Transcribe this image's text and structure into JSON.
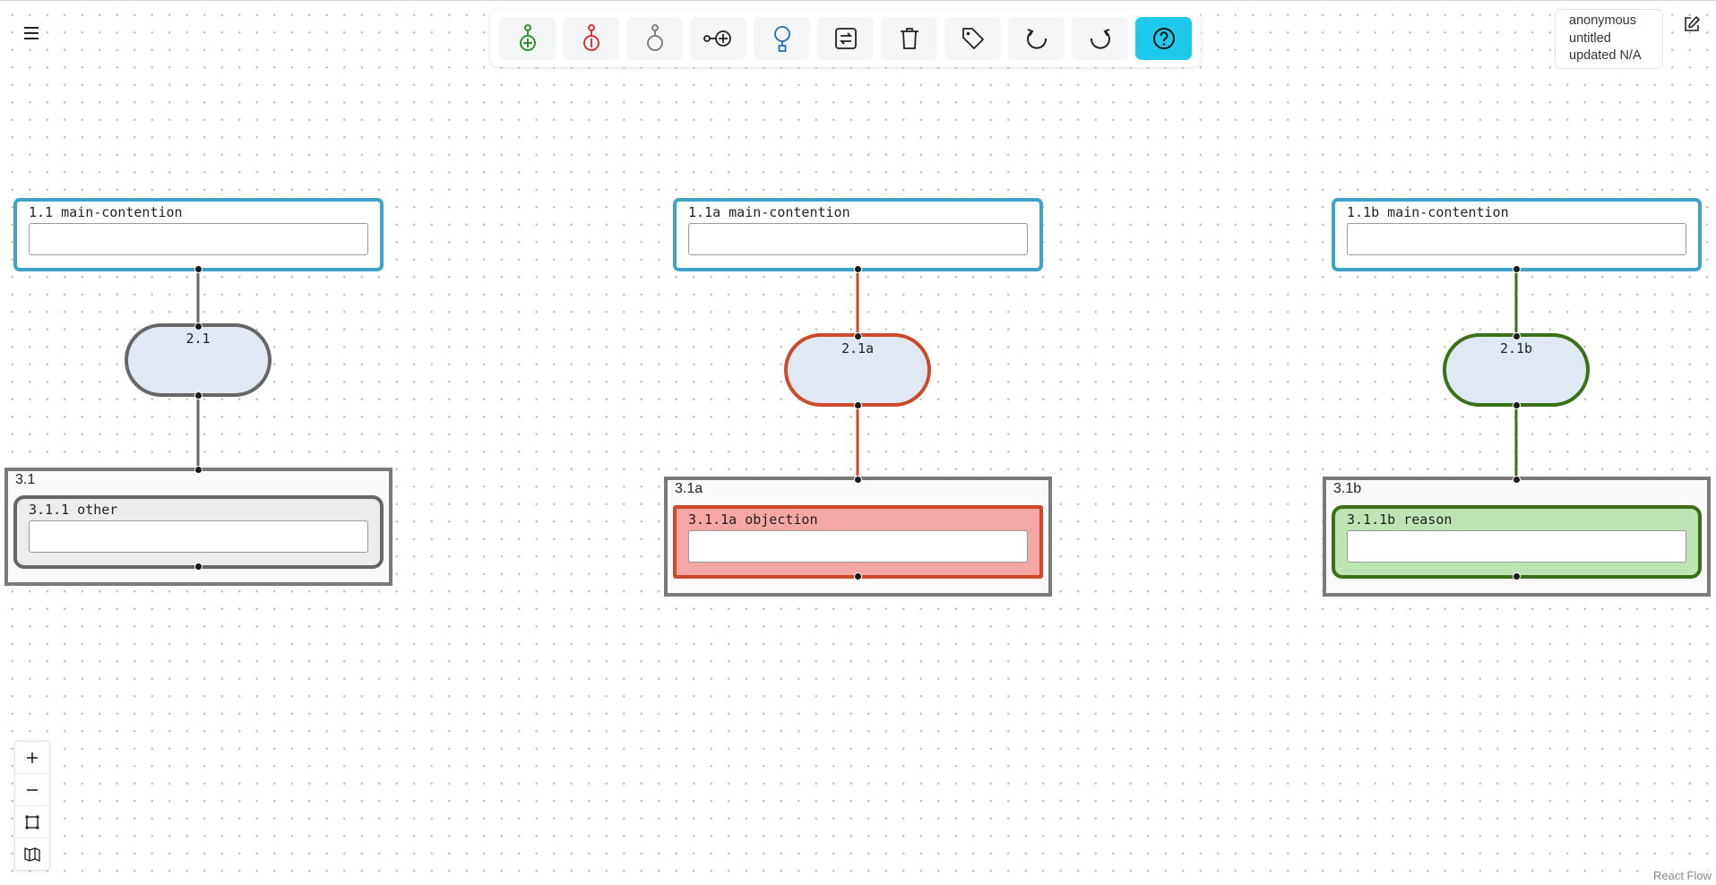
{
  "toolbar": {
    "buttons": [
      {
        "name": "add-reason-button",
        "icon": "add-reason-icon",
        "color": "#1a8c1a"
      },
      {
        "name": "add-objection-button",
        "icon": "add-objection-icon",
        "color": "#e02020"
      },
      {
        "name": "add-other-button",
        "icon": "add-other-icon",
        "color": "#777777"
      },
      {
        "name": "add-premise-button",
        "icon": "link-plus-icon",
        "color": "#222222"
      },
      {
        "name": "add-group-button",
        "icon": "pin-icon",
        "color": "#1f6fb5"
      },
      {
        "name": "toggle-type-button",
        "icon": "swap-icon",
        "color": "#222222"
      },
      {
        "name": "delete-button",
        "icon": "trash-icon",
        "color": "#222222"
      },
      {
        "name": "label-button",
        "icon": "tag-icon",
        "color": "#222222"
      },
      {
        "name": "undo-button",
        "icon": "undo-icon",
        "color": "#222222"
      },
      {
        "name": "redo-button",
        "icon": "redo-icon",
        "color": "#222222"
      },
      {
        "name": "help-button",
        "icon": "help-icon",
        "color": "#1ec9eb"
      }
    ]
  },
  "info": {
    "user": "anonymous",
    "map_name": "untitled",
    "updated": "updated N/A"
  },
  "nodes": {
    "c1": {
      "label": "1.1 main-contention",
      "value": ""
    },
    "c1a": {
      "label": "1.1a main-contention",
      "value": ""
    },
    "c1b": {
      "label": "1.1b main-contention",
      "value": ""
    },
    "p1": {
      "label": "2.1"
    },
    "p1a": {
      "label": "2.1a"
    },
    "p1b": {
      "label": "2.1b"
    },
    "g1": {
      "label": "3.1"
    },
    "g1a": {
      "label": "3.1a"
    },
    "g1b": {
      "label": "3.1b"
    },
    "o1": {
      "label": "3.1.1 other",
      "value": ""
    },
    "o1a": {
      "label": "3.1.1a objection",
      "value": ""
    },
    "o1b": {
      "label": "3.1.1b reason",
      "value": ""
    }
  },
  "colors": {
    "main": "#3fa3c7",
    "other": "#666666",
    "objection": "#cc4a2a",
    "reason": "#3b7017",
    "pill_fill": "#e0e8f3"
  },
  "zoom_controls": [
    "zoom-in",
    "zoom-out",
    "fit-view",
    "toggle-minimap"
  ],
  "attribution": "React Flow"
}
